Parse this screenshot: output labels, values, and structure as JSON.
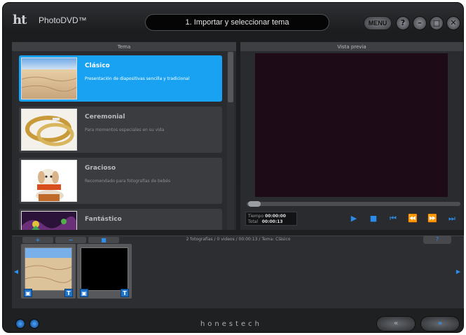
{
  "header": {
    "logo_text": "ht",
    "app_title": "PhotoDVD™",
    "step_title": "1. Importar y seleccionar tema",
    "menu_label": "MENU",
    "help_label": "?",
    "minimize_label": "–",
    "restore_label": "□",
    "close_label": "✕"
  },
  "tema": {
    "heading": "Tema",
    "items": [
      {
        "name": "Clásico",
        "desc": "Presentación de diapositivas sencilla y tradicional",
        "selected": true,
        "thumb": "sand-thumbnail"
      },
      {
        "name": "Ceremonial",
        "desc": "Para momentos especiales en su vida",
        "selected": false,
        "thumb": "rings-thumbnail"
      },
      {
        "name": "Gracioso",
        "desc": "Recomendado para fotografías de bebés",
        "selected": false,
        "thumb": "puppy-thumbnail"
      },
      {
        "name": "Fantástico",
        "desc": "",
        "selected": false,
        "thumb": "fantasy-thumbnail"
      }
    ]
  },
  "preview": {
    "heading": "Vista previa",
    "time_label": "Tiempo",
    "time_value": "00:00:00",
    "total_label": "Total",
    "total_value": "00:00:13",
    "controls": [
      "play-icon",
      "stop-icon",
      "skip-start-icon",
      "rewind-icon",
      "fast-forward-icon",
      "skip-end-icon"
    ]
  },
  "timeline": {
    "add_label": "+",
    "remove_label": "−",
    "third_label": "■",
    "info": "2 fotografías / 0 videos / 00:00:13 / Tema: Clásico",
    "help_label": "?",
    "badge_left": "▣",
    "badge_right": "T"
  },
  "footer": {
    "brand": "honestech",
    "back_label": "«",
    "next_label": "»"
  },
  "colors": {
    "accent": "#19a2f2",
    "icon_blue": "#2c8fee",
    "background": "#1f2022"
  }
}
